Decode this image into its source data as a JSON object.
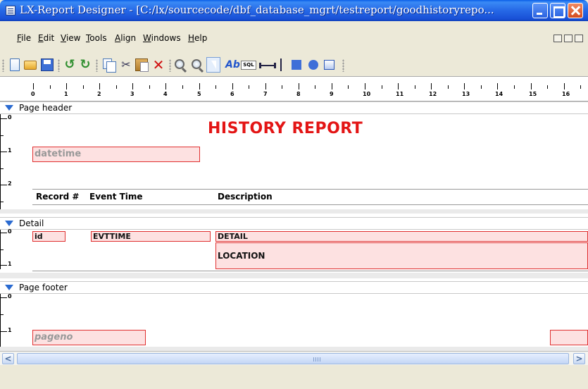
{
  "window": {
    "title": "LX-Report Designer - [C:/lx/sourcecode/dbf_database_mgrt/testreport/goodhistoryrepo..."
  },
  "menu": [
    {
      "label": "File"
    },
    {
      "label": "Edit"
    },
    {
      "label": "View"
    },
    {
      "label": "Tools"
    },
    {
      "label": "Align"
    },
    {
      "label": "Windows"
    },
    {
      "label": "Help"
    }
  ],
  "toolbar": {
    "icons": [
      "new-page-icon",
      "open-folder-icon",
      "save-icon",
      "undo-icon",
      "redo-icon",
      "copy-icon",
      "cut-icon",
      "paste-icon",
      "delete-icon",
      "zoom-in-icon",
      "zoom-out-icon",
      "pointer-icon",
      "label-icon",
      "sql-field-icon",
      "horizontal-line-icon",
      "vertical-line-icon",
      "rectangle-icon",
      "circle-icon",
      "image-icon"
    ],
    "sql_text": "SQL"
  },
  "ruler": {
    "labels": [
      "0",
      "1",
      "2",
      "3",
      "4",
      "5",
      "6",
      "7",
      "8",
      "9",
      "10",
      "11",
      "12",
      "13",
      "14",
      "15",
      "16"
    ]
  },
  "sections": {
    "page_header": {
      "title": "Page header",
      "report_title": "HISTORY REPORT",
      "datetime_field": "datetime",
      "columns": [
        "Record #",
        "Event Time",
        "Description"
      ],
      "ruler_labels": [
        "0",
        "1",
        "2"
      ]
    },
    "detail": {
      "title": "Detail",
      "fields": {
        "id": "id",
        "evttime": "EVTTIME",
        "detail": "DETAIL",
        "location": "LOCATION"
      },
      "ruler_labels": [
        "0",
        "1"
      ]
    },
    "page_footer": {
      "title": "Page footer",
      "pageno_field": "pageno",
      "ruler_labels": [
        "0",
        "1"
      ]
    }
  },
  "scrollbar": {
    "left_arrow": "<",
    "right_arrow": ">"
  },
  "colors": {
    "accent_title": "#e31515",
    "field_border": "#e03030",
    "field_fill": "#fde1e1"
  }
}
